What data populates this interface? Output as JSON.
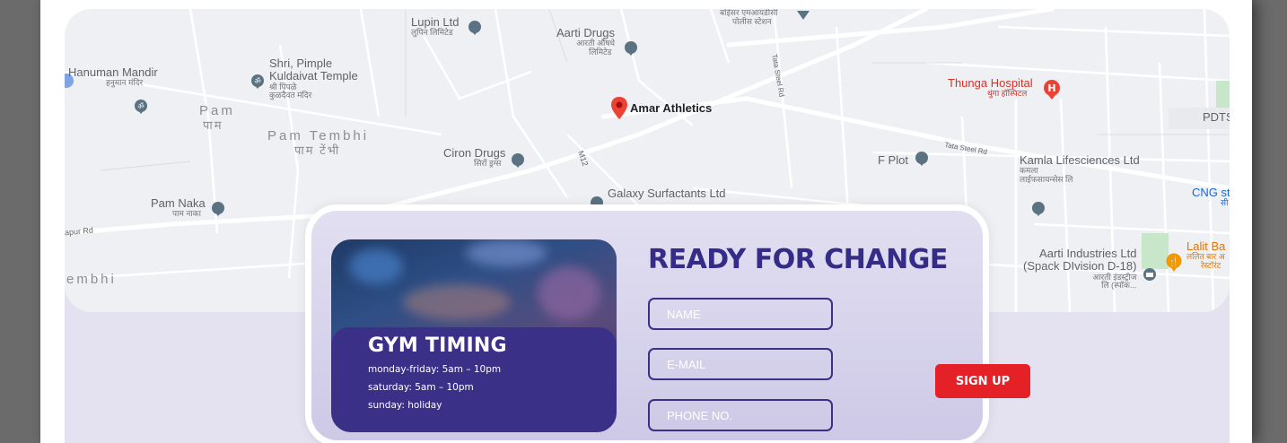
{
  "map": {
    "labels": {
      "lupin": "Lupin Ltd",
      "lupin_sub": "लुपिन लिमिटेड",
      "aarti_drugs": "Aarti Drugs",
      "aarti_drugs_sub1": "आरती औषधे",
      "aarti_drugs_sub2": "लिमिटेड",
      "boisar_police1": "बोईसर एमआयडीसी",
      "boisar_police2": "पोलीस स्टेशन",
      "hanuman": "Hanuman Mandir",
      "hanuman_sub": "हनुमान मंदिर",
      "shri_pimple1": "Shri, Pimple",
      "shri_pimple2": "Kuldaivat Temple",
      "shri_pimple_sub1": "श्री पिंपळे",
      "shri_pimple_sub2": "कुळदैवत मंदिर",
      "pam": "Pam",
      "pam_sub": "पाम",
      "pam_tembhi": "Pam Tembhi",
      "pam_tembhi_sub": "पाम टेंभी",
      "amar": "Amar Athletics",
      "ciron": "Ciron Drugs",
      "ciron_sub": "सिरों ड्रग्स",
      "galaxy": "Galaxy Surfactants Ltd",
      "m12": "M12",
      "tata_steel_rd_v": "Tata Steel Rd",
      "tata_steel_rd": "Tata Steel Rd",
      "thunga": "Thunga Hospital",
      "thunga_sub": "थुंगा हॉस्पिटल",
      "pdts": "PDTS",
      "f_plot": "F Plot",
      "kamla": "Kamla Lifesciences Ltd",
      "kamla_sub1": "कमला",
      "kamla_sub2": "लाईफसायन्सेस लि",
      "cng": "CNG st",
      "cng_sub": "सी",
      "pam_naka": "Pam Naka",
      "pam_naka_sub": "पाम नाका",
      "apur_rd": "apur Rd",
      "embhi": "embhi",
      "aarti_ind1": "Aarti Industries Ltd",
      "aarti_ind2": "(Spack DIvision D-18)",
      "aarti_ind_sub1": "आरती इंडस्ट्रीज",
      "aarti_ind_sub2": "लि (स्पॉक...",
      "lalit1": "Lalit Ba",
      "lalit2": "ललित बार अ",
      "lalit3": "रेस्टॉरंट"
    }
  },
  "gym_timing": {
    "title": "GYM TIMING",
    "line1": "monday-friday: 5am – 10pm",
    "line2": "saturday: 5am – 10pm",
    "line3": "sunday: holiday"
  },
  "form": {
    "title": "READY FOR CHANGE",
    "name_placeholder": "NAME",
    "email_placeholder": "E-MAIL",
    "phone_placeholder": "PHONE NO.",
    "signup_label": "SIGN UP"
  },
  "colors": {
    "brand_purple": "#342c86",
    "signup_red": "#e32127",
    "pin_red": "#ea4335"
  }
}
